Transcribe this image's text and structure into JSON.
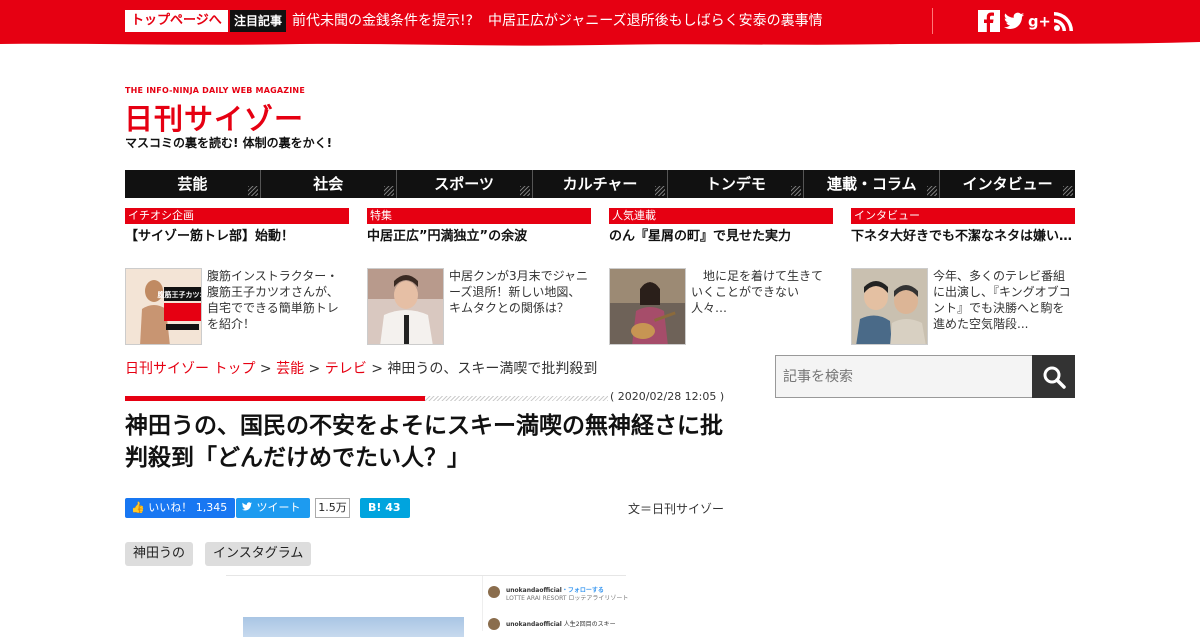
{
  "topbar": {
    "top_page_button": "トップページへ",
    "featured_tag": "注目記事",
    "headlines": [
      "前代未聞の金銭条件を提示!?",
      "中居正広がジャニーズ退所後もしばらく安泰の裏事情"
    ],
    "social_icons": [
      "facebook-icon",
      "twitter-icon",
      "google-plus-icon",
      "rss-icon"
    ]
  },
  "logo": {
    "tagline": "THE INFO-NINJA DAILY WEB MAGAZINE",
    "name": "日刊サイゾー",
    "subtitle": "マスコミの裏を読む! 体制の裏をかく!"
  },
  "nav": {
    "items": [
      "芸能",
      "社会",
      "スポーツ",
      "カルチャー",
      "トンデモ",
      "連載・コラム",
      "インタビュー"
    ]
  },
  "cards": [
    {
      "category": "イチオシ企画",
      "title": "【サイゾー筋トレ部】始動！",
      "desc": "腹筋インストラクター・腹筋王子カツオさんが、自宅でできる簡単筋トレを紹介！",
      "thumb_text": "腹筋王子カツオ"
    },
    {
      "category": "特集",
      "title": "中居正広”円満独立”の余波",
      "desc": "中居クンが3月末でジャニーズ退所！新しい地図、キムタクとの関係は？"
    },
    {
      "category": "人気連載",
      "title": "のん『星屑の町』で見せた実力",
      "desc": "　地に足を着けて生きていくことができない人々…"
    },
    {
      "category": "インタビュー",
      "title": "下ネタ大好きでも不潔なネタは嫌い…",
      "desc": "今年、多くのテレビ番組に出演し、『キングオブコント』でも決勝へと駒を進めた空気階段..."
    }
  ],
  "breadcrumb": {
    "home": "日刊サイゾー トップ",
    "sep": ">",
    "level1": "芸能",
    "level2": "テレビ",
    "current": "神田うの、スキー満喫で批判殺到"
  },
  "search": {
    "placeholder": "記事を検索"
  },
  "article": {
    "date": "( 2020/02/28 12:05 )",
    "title": "神田うの、国民の不安をよそにスキー満喫の無神経さに批判殺到「どんだけめでたい人？」",
    "author": "文＝日刊サイゾー"
  },
  "share": {
    "like_label": "いいね！ 1,345",
    "tweet_label": "ツイート",
    "tweet_count": "1.5万",
    "hatena_label": "B! 43"
  },
  "tags": [
    "神田うの",
    "インスタグラム"
  ],
  "embed": {
    "account": "unokandaofficial",
    "follow": "・フォローする",
    "location": "LOTTE ARAI RESORT ロッテアライリゾート",
    "caption": "人生2回目のスキー"
  },
  "colors": {
    "brand": "#e60012",
    "nav": "#111111"
  }
}
